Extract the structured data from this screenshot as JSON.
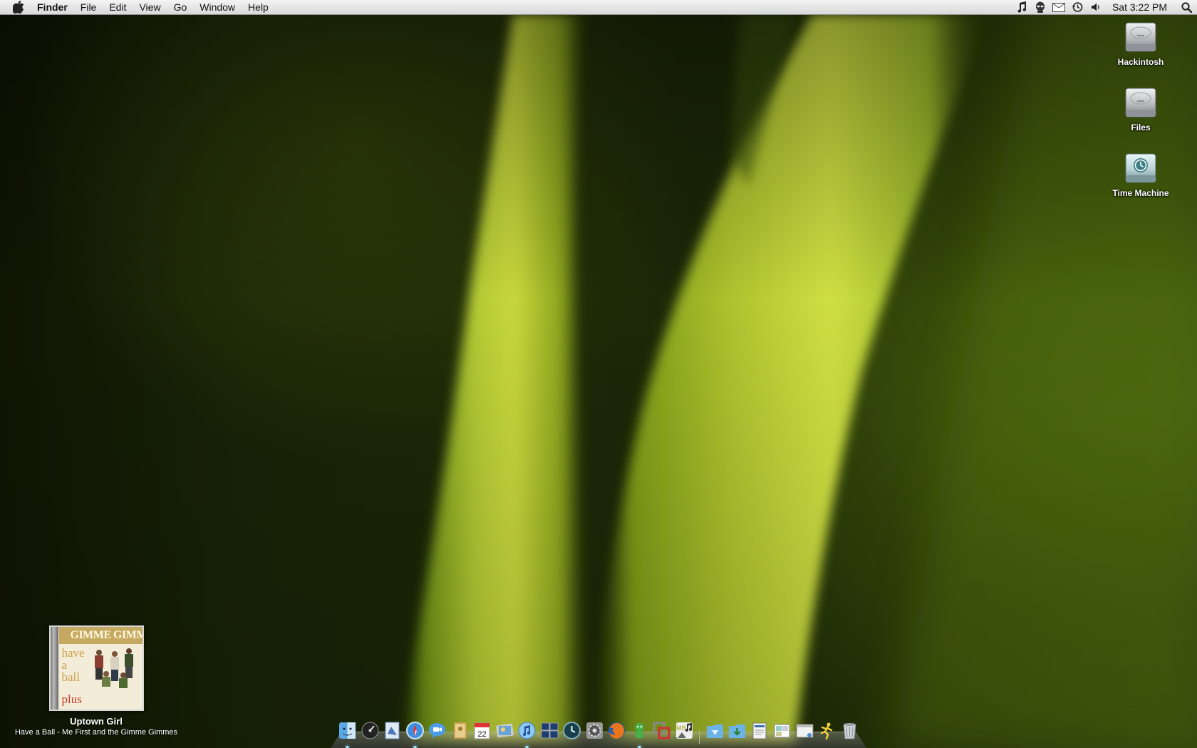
{
  "menubar": {
    "app_name": "Finder",
    "menus": [
      "File",
      "Edit",
      "View",
      "Go",
      "Window",
      "Help"
    ],
    "status_icons": [
      "music-note-icon",
      "alien-head-icon",
      "mail-icon",
      "time-machine-icon",
      "volume-icon"
    ],
    "clock": "Sat 3:22 PM"
  },
  "desktop_icons": [
    {
      "label": "Hackintosh",
      "icon": "hard-drive-icon"
    },
    {
      "label": "Files",
      "icon": "hard-drive-icon"
    },
    {
      "label": "Time Machine",
      "icon": "time-machine-drive-icon"
    }
  ],
  "now_playing": {
    "album_title_art": "GIMME GIMMES",
    "album_words": [
      "have",
      "a",
      "ball"
    ],
    "album_plus": "plus",
    "song": "Uptown Girl",
    "album_artist": "Have a Ball - Me First and the Gimme Gimmes"
  },
  "dock": {
    "items": [
      {
        "icon": "finder-icon",
        "running": true
      },
      {
        "icon": "dashboard-icon",
        "running": false
      },
      {
        "icon": "mail-stamp-icon",
        "running": false
      },
      {
        "icon": "safari-icon",
        "running": true
      },
      {
        "icon": "ichat-icon",
        "running": false
      },
      {
        "icon": "address-book-icon",
        "running": false
      },
      {
        "icon": "ical-icon",
        "running": false,
        "date": "22"
      },
      {
        "icon": "iphoto-icon",
        "running": false
      },
      {
        "icon": "itunes-icon",
        "running": true
      },
      {
        "icon": "spaces-icon",
        "running": false
      },
      {
        "icon": "time-machine-icon",
        "running": false
      },
      {
        "icon": "system-preferences-icon",
        "running": false
      },
      {
        "icon": "firefox-icon",
        "running": false
      },
      {
        "icon": "adium-icon",
        "running": true
      },
      {
        "icon": "vmware-icon",
        "running": false
      },
      {
        "icon": "musicbrainz-picard-icon",
        "running": false,
        "badge": "MB"
      },
      {
        "icon": "applications-folder-icon",
        "running": false
      },
      {
        "icon": "downloads-folder-icon",
        "running": false
      },
      {
        "icon": "documents-stack-icon",
        "running": false
      },
      {
        "icon": "pictures-stack-icon",
        "running": false
      },
      {
        "icon": "window-stack-icon",
        "running": false
      },
      {
        "icon": "running-man-icon",
        "running": false
      },
      {
        "icon": "trash-icon",
        "running": false
      }
    ]
  },
  "colors": {
    "menubar": "#e6e6e6",
    "wallpaper_dark": "#16200a",
    "wallpaper_leaf": "#c5d53a"
  }
}
